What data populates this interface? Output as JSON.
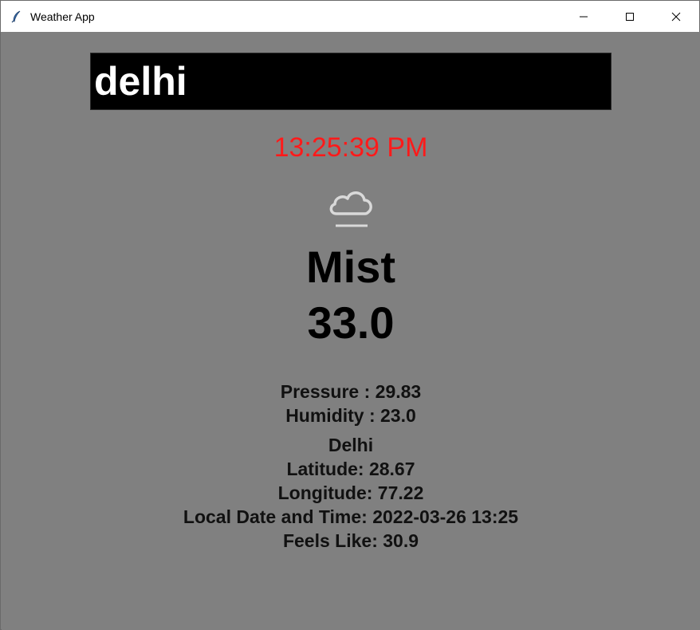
{
  "window": {
    "title": "Weather App",
    "icon": "feather-icon",
    "controls": [
      "minimize-icon",
      "maximize-icon",
      "close-icon"
    ]
  },
  "search": {
    "value": "delhi"
  },
  "clock": {
    "time": "13:25:39 PM",
    "color": "#ff1a1a"
  },
  "weather": {
    "icon": "mist-cloud-icon",
    "condition": "Mist",
    "temperature": "33.0"
  },
  "details": {
    "pressure": "Pressure : 29.83",
    "humidity": "Humidity : 23.0"
  },
  "location": {
    "city": "Delhi",
    "latitude": "Latitude: 28.67",
    "longitude": "Longitude: 77.22",
    "local_datetime": "Local Date and Time: 2022-03-26 13:25",
    "feels_like": "Feels Like: 30.9"
  },
  "colors": {
    "background": "#808080",
    "entry_background": "#000000",
    "entry_text": "#ffffff",
    "text": "#000000"
  }
}
